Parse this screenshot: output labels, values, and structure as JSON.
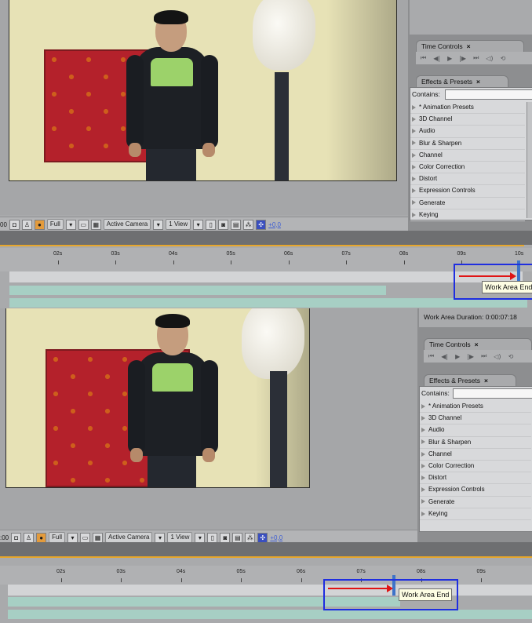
{
  "toolbar": {
    "time_prefix": "00",
    "time_prefix_bottom": ":00",
    "resolution": "Full",
    "camera": "Active Camera",
    "view": "1 View",
    "exposure": "+0,0"
  },
  "panels": {
    "time_controls": "Time Controls",
    "effects_presets": "Effects & Presets",
    "contains_label": "Contains:",
    "close_glyph": "×",
    "work_area_duration": "Work Area Duration: 0:00:07:18"
  },
  "effects_list": [
    "* Animation Presets",
    "3D Channel",
    "Audio",
    "Blur & Sharpen",
    "Channel",
    "Color Correction",
    "Distort",
    "Expression Controls",
    "Generate",
    "Keying"
  ],
  "timeline_top": {
    "ticks": [
      "02s",
      "03s",
      "04s",
      "05s",
      "06s",
      "07s",
      "08s",
      "09s",
      "10s"
    ],
    "tooltip": "Work Area End"
  },
  "timeline_bottom": {
    "ticks": [
      "02s",
      "03s",
      "04s",
      "05s",
      "06s",
      "07s",
      "08s",
      "09s"
    ],
    "tooltip": "Work Area End"
  },
  "colors": {
    "highlight_box": "#1f2ee0",
    "arrow": "#e01414",
    "work_area_bar": "#a7cfc4",
    "timeline_accent": "#e7a72c"
  }
}
